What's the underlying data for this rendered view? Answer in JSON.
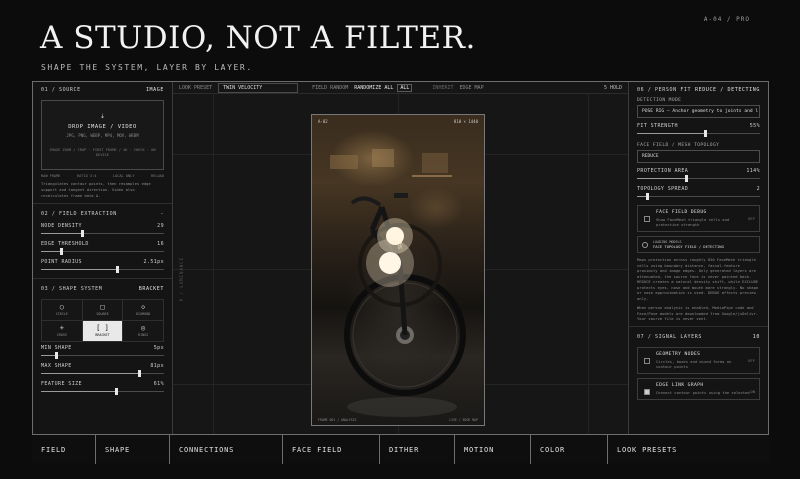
{
  "hero": {
    "title": "A STUDIO, NOT A FILTER.",
    "subtitle": "SHAPE THE SYSTEM, LAYER BY LAYER.",
    "version": "A-04 / PRO"
  },
  "left": {
    "source": {
      "header": "01 / SOURCE",
      "tag": "IMAGE",
      "upload_icon": "upload-icon",
      "drop_title": "DROP IMAGE / VIDEO",
      "drop_formats": "JPG, PNG, WEBP, MP4, MOV, WEBM",
      "drop_meta": "IMAGE ZOOM / CROP · FIRST FRAME / 4K · CHECK · ON DEVICE",
      "mini_left": "RAW FRAME",
      "mini_mid": "RATIO 3:4",
      "mini_mid2": "LOCAL ONLY",
      "mini_right": "RELOAD",
      "note": "Triangulates contour points, then resamples edge support and tangent direction. Video also recalculates frame data Δ."
    },
    "field": {
      "header": "02 / FIELD EXTRACTION",
      "tag": "-",
      "params": [
        {
          "label": "NODE DENSITY",
          "value": "29",
          "level": 0.33
        },
        {
          "label": "EDGE THRESHOLD",
          "value": "16",
          "level": 0.16
        },
        {
          "label": "POINT RADIUS",
          "value": "2.51px",
          "level": 0.62
        }
      ]
    },
    "shape": {
      "header": "03 / SHAPE SYSTEM",
      "tag": "BRACKET",
      "options": [
        {
          "glyph": "○",
          "label": "CIRCLE",
          "icon": "circle-icon"
        },
        {
          "glyph": "□",
          "label": "SQUARE",
          "icon": "square-icon"
        },
        {
          "glyph": "◇",
          "label": "DIAMOND",
          "icon": "diamond-icon"
        },
        {
          "glyph": "+",
          "label": "CROSS",
          "icon": "cross-icon"
        },
        {
          "glyph": "[ ]",
          "label": "BRACKET",
          "icon": "bracket-icon"
        },
        {
          "glyph": "◎",
          "label": "RINGS",
          "icon": "rings-icon"
        }
      ],
      "params": [
        {
          "label": "MIN SHAPE",
          "value": "5px",
          "level": 0.12
        },
        {
          "label": "MAX SHAPE",
          "value": "81px",
          "level": 0.8
        },
        {
          "label": "FEATURE SIZE",
          "value": "61%",
          "level": 0.61
        }
      ]
    }
  },
  "center": {
    "look_preset_label": "LOOK PRESET",
    "look_preset_value": "TWIN VELOCITY",
    "field_random_label": "FIELD RANDOM",
    "randomize_label": "RANDOMIZE ALL",
    "all_label": "ALL",
    "inherit_label": "INHERIT",
    "edge_map_label": "EDGE MAP",
    "hold_label": "5 HOLD",
    "side_label": "P / LUMINANCE",
    "preview": {
      "corner_left": "A-02",
      "corner_right": "810 × 1440",
      "bottom_left": "FRAME 001 / ANALYSIS",
      "bottom_right": "LIVE / EDGE MAP"
    }
  },
  "right": {
    "person": {
      "header": "06 / PERSON FIT",
      "tag": "REDUCE / DETECTING",
      "detection_label": "DETECTION MODE",
      "detection_value": "POSE RIG — Anchor geometry to joints and l",
      "params": [
        {
          "label": "FIT STRENGTH",
          "value": "55%",
          "level": 0.55
        },
        {
          "label": "PROTECTION AREA",
          "value": "114%",
          "level": 0.4
        },
        {
          "label": "TOPOLOGY SPREAD",
          "value": "2",
          "level": 0.08
        }
      ],
      "mesh_label": "FACE FIELD / MESH TOPOLOGY",
      "mesh_value": "REDUCE",
      "debug": {
        "title": "FACE FIELD DEBUG",
        "desc": "Show FaceMesh triangle cells and protection strength",
        "state": "OFF"
      },
      "loading_a": "LOADING MODELS",
      "loading_b": "FACE TOPOLOGY FIELD / DETECTING",
      "para1": "Maps protection across roughly 850 FaceMesh triangle cells using boundary distance, facial-feature proximity and image edges. Only generated layers are attenuated, the source face is never painted back. REDUCE creates a natural density shift, while EXCLUDE protects eyes, nose and mouth more strongly. No shape or nose approximation is used. DEBUG affects preview only.",
      "para2": "When person analysis is enabled, MediaPipe code and Face/Pose models are downloaded from Google/jsDelivr. Your source file is never sent."
    },
    "signal": {
      "header": "07 / SIGNAL LAYERS",
      "tag": "10",
      "items": [
        {
          "title": "GEOMETRY NODES",
          "desc": "Circles, boxes and mixed forms on contour points",
          "state": "OFF",
          "on": false
        },
        {
          "title": "EDGE LINK GRAPH",
          "desc": "Connect contour points using the selected",
          "state": "ON",
          "on": true
        }
      ]
    }
  },
  "nav": {
    "items": [
      "FIELD",
      "SHAPE",
      "CONNECTIONS",
      "FACE FIELD",
      "DITHER",
      "MOTION",
      "COLOR",
      "LOOK PRESETS"
    ]
  }
}
